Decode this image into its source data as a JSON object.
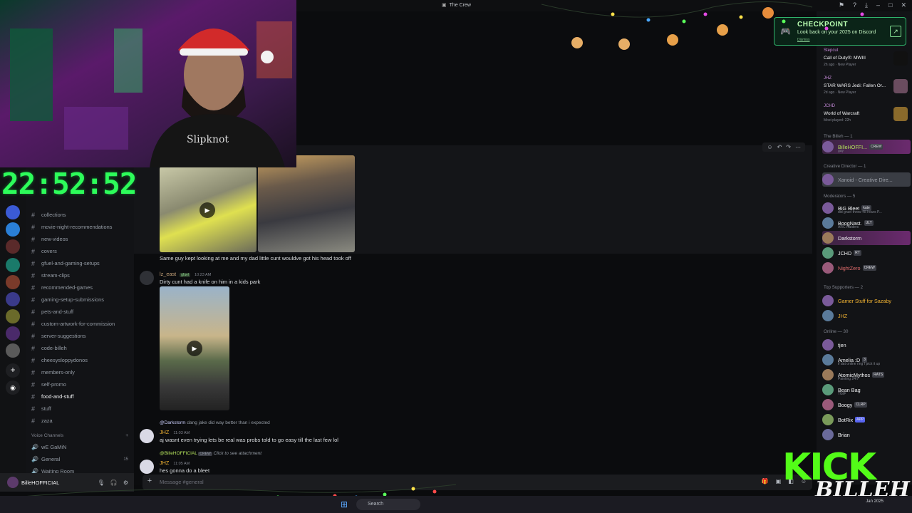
{
  "window": {
    "title": "The Crew"
  },
  "overlay": {
    "clock": "22:52:52",
    "kick_text": "KICK",
    "kick_handle": "BILLEH"
  },
  "channels": [
    {
      "name": "collections",
      "active": false
    },
    {
      "name": "movie-night-recommendations",
      "active": false
    },
    {
      "name": "new-videos",
      "active": false
    },
    {
      "name": "covers",
      "active": false
    },
    {
      "name": "gfuel-and-gaming-setups",
      "active": false
    },
    {
      "name": "stream-clips",
      "active": false
    },
    {
      "name": "recommended-games",
      "active": false
    },
    {
      "name": "gaming-setup-submissions",
      "active": false
    },
    {
      "name": "pets-and-stuff",
      "active": false
    },
    {
      "name": "custom-artwork-for-commission",
      "active": false
    },
    {
      "name": "server-suggestions",
      "active": false
    },
    {
      "name": "code-billeh",
      "active": false
    },
    {
      "name": "cheesysloppydonos",
      "active": false
    },
    {
      "name": "members-only",
      "active": false
    },
    {
      "name": "self-promo",
      "active": false
    },
    {
      "name": "food-and-stuff",
      "active": true
    },
    {
      "name": "stuff",
      "active": false
    },
    {
      "name": "zaza",
      "active": false
    }
  ],
  "voice": {
    "header": "Voice Channels",
    "channels": [
      {
        "name": "wE GaMiN",
        "count": ""
      },
      {
        "name": "General",
        "count": "15"
      },
      {
        "name": "Waiting Room",
        "count": ""
      }
    ]
  },
  "user": {
    "name": "BilleHOFFICIAL"
  },
  "messages": {
    "m1_text": "Same guy kept looking at me and my dad little cunt wouldve got his head took off",
    "m2_author": "lz_east",
    "m2_tag": "gfuel",
    "m2_time": "10:23 AM",
    "m2_text": "Dirty cunt had a knife on him in a kids park",
    "m3_reply_who": "@Darkstorm",
    "m3_reply_text": "dang jake did way better than i expected",
    "m3_author": "JHZ",
    "m3_time": "11:03 AM",
    "m3_text": "aj wasnt even trying lets be real was probs told to go easy till the last few lol",
    "m4_reply_who": "@BilleHOFFICIAL",
    "m4_reply_tag": "CREW",
    "m4_reply_text": "Click to see attachment",
    "m4_author": "JHZ",
    "m4_time": "11:05 AM",
    "m4_text": "hes gonna do a bleet"
  },
  "composer": {
    "placeholder": "Message #general"
  },
  "checkpoint": {
    "title": "CHECKPOINT",
    "subtitle": "Look back on your 2025 on Discord",
    "dismiss": "Dismiss"
  },
  "activities": [
    {
      "name": "Stepcut",
      "game": "Call of Duty®: MWIII",
      "meta": "2h ago · New Player",
      "color": "#111"
    },
    {
      "name": "JHZ",
      "game": "STAR WARS Jedi: Fallen Or...",
      "meta": "2d ago · New Player",
      "color": "#6a4c5f"
    },
    {
      "name": "JCHD",
      "game": "World of Warcraft",
      "meta": "Most played: 22h",
      "color": "#8a6a2b"
    }
  ],
  "member_groups": {
    "billeh": "The Billeh — 1",
    "creative": "Creative Director — 1",
    "mods": "Moderators — 5",
    "supporters": "Top Supporters — 2",
    "online": "Online — 30"
  },
  "members": {
    "billeh": [
      {
        "name": "BilleHOFFI...",
        "tag": "CREW",
        "sub": "gay",
        "color": "#b4e35c"
      }
    ],
    "creative": [
      {
        "name": "Xanoid - Creative Dire...",
        "tag": "",
        "sub": "",
        "color": "#9a9ea6"
      }
    ],
    "mods": [
      {
        "name": "BiG Bleet",
        "tag": "kate",
        "sub": "did gruel throw 48 hours P...",
        "color": "#f2f3f5"
      },
      {
        "name": "BoogNast.",
        "tag": "ULT",
        "sub": "ARC Raiders",
        "color": "#f2f3f5"
      },
      {
        "name": "Darkstorm",
        "tag": "",
        "sub": "",
        "color": "#f2f3f5"
      },
      {
        "name": "JCHD",
        "tag": "RT",
        "sub": "",
        "color": "#f2f3f5"
      },
      {
        "name": "NightZero",
        "tag": "CREW",
        "sub": "",
        "color": "#e06c6c"
      }
    ],
    "supporters": [
      {
        "name": "Gamer Stuff for Sazaby",
        "tag": "",
        "sub": "",
        "color": "#f0b232"
      },
      {
        "name": "JHZ",
        "tag": "",
        "sub": "",
        "color": "#f0b232"
      }
    ],
    "online": [
      {
        "name": "tjen",
        "tag": "",
        "sub": "",
        "color": "#f2f3f5"
      },
      {
        "name": "Amelia :D",
        "tag": "3",
        "sub": "if dat online ring I pick it up",
        "color": "#f2f3f5"
      },
      {
        "name": "AtomicMythos",
        "tag": "RATS",
        "sub": "Painting 24/7",
        "color": "#f2f3f5"
      },
      {
        "name": "Bean Bag",
        "tag": "",
        "sub": "TGIF",
        "color": "#f2f3f5"
      },
      {
        "name": "Boogy",
        "tag": "CLRP",
        "sub": "",
        "color": "#f2f3f5"
      },
      {
        "name": "BotRix",
        "tag": "APP",
        "sub": "",
        "color": "#f2f3f5"
      },
      {
        "name": "Brian",
        "tag": "",
        "sub": "",
        "color": "#f2f3f5"
      }
    ]
  },
  "taskbar": {
    "search": "Search",
    "date": "Jan 2025"
  },
  "colors": {
    "clock": "#2dfc5a",
    "kick": "#53fc18",
    "accent": "#5865f2"
  }
}
